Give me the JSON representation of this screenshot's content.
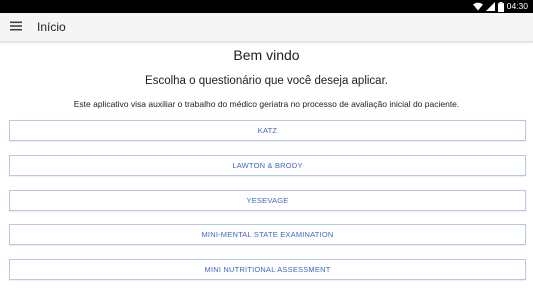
{
  "status_bar": {
    "time": "04:30",
    "icons": [
      "wifi-icon",
      "signal-icon",
      "battery-icon"
    ]
  },
  "app_bar": {
    "menu_icon": "hamburger-menu-icon",
    "title": "Início"
  },
  "main": {
    "welcome": "Bem vindo",
    "prompt": "Escolha o questionário que você deseja aplicar.",
    "description": "Este aplicativo visa auxiliar o trabalho do médico geriatra no processo de avaliação inicial do paciente.",
    "questionnaires": [
      {
        "label": "KATZ"
      },
      {
        "label": "LAWTON & BRODY"
      },
      {
        "label": "YESEVAGE"
      },
      {
        "label": "MINI-MENTAL STATE EXAMINATION"
      },
      {
        "label": "MINI NUTRITIONAL ASSESSMENT"
      }
    ]
  },
  "colors": {
    "accent_text": "#3f66c9",
    "button_border": "#b9c6e3",
    "app_bar_bg": "#f5f5f5",
    "status_bar_bg": "#000000"
  }
}
